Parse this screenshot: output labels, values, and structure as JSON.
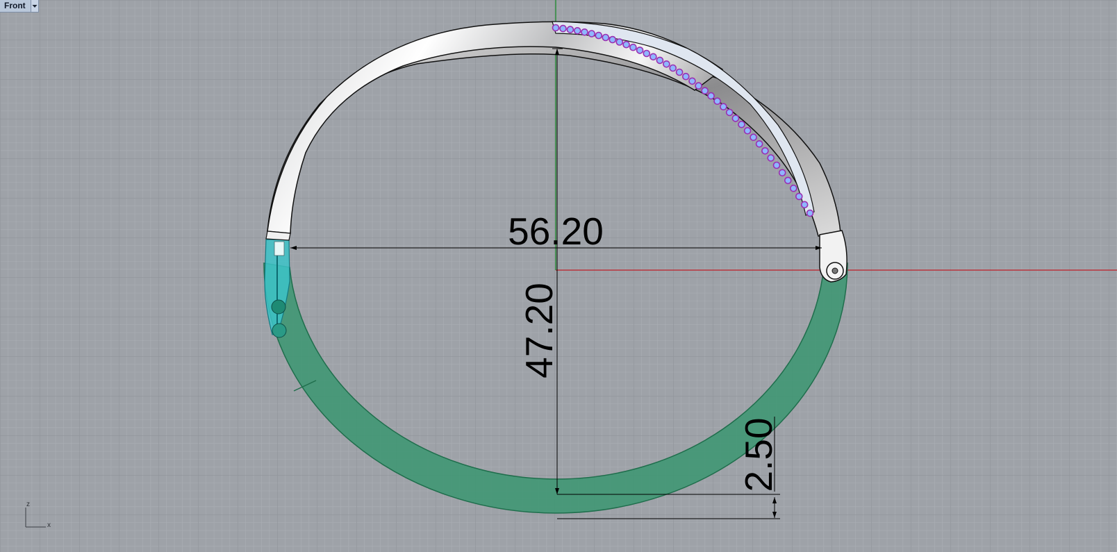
{
  "viewport": {
    "name": "Front",
    "menu_icon": "chevron-down-icon"
  },
  "dimensions": {
    "width": "56.20",
    "height": "47.20",
    "thickness": "2.50"
  },
  "axis_icon": {
    "z_label": "z",
    "x_label": "x"
  },
  "colors": {
    "background": "#9ea2a8",
    "grid_minor": "#acb0b6",
    "grid_major": "#8f9399",
    "x_axis": "#b8323a",
    "y_axis": "#2d8c3c",
    "metal": "#f4f4f4",
    "selected_band": "#3d9672",
    "clasp": "#3cc3c8",
    "gems": "#8fb6ff",
    "gem_prongs": "#9b2fb1"
  }
}
